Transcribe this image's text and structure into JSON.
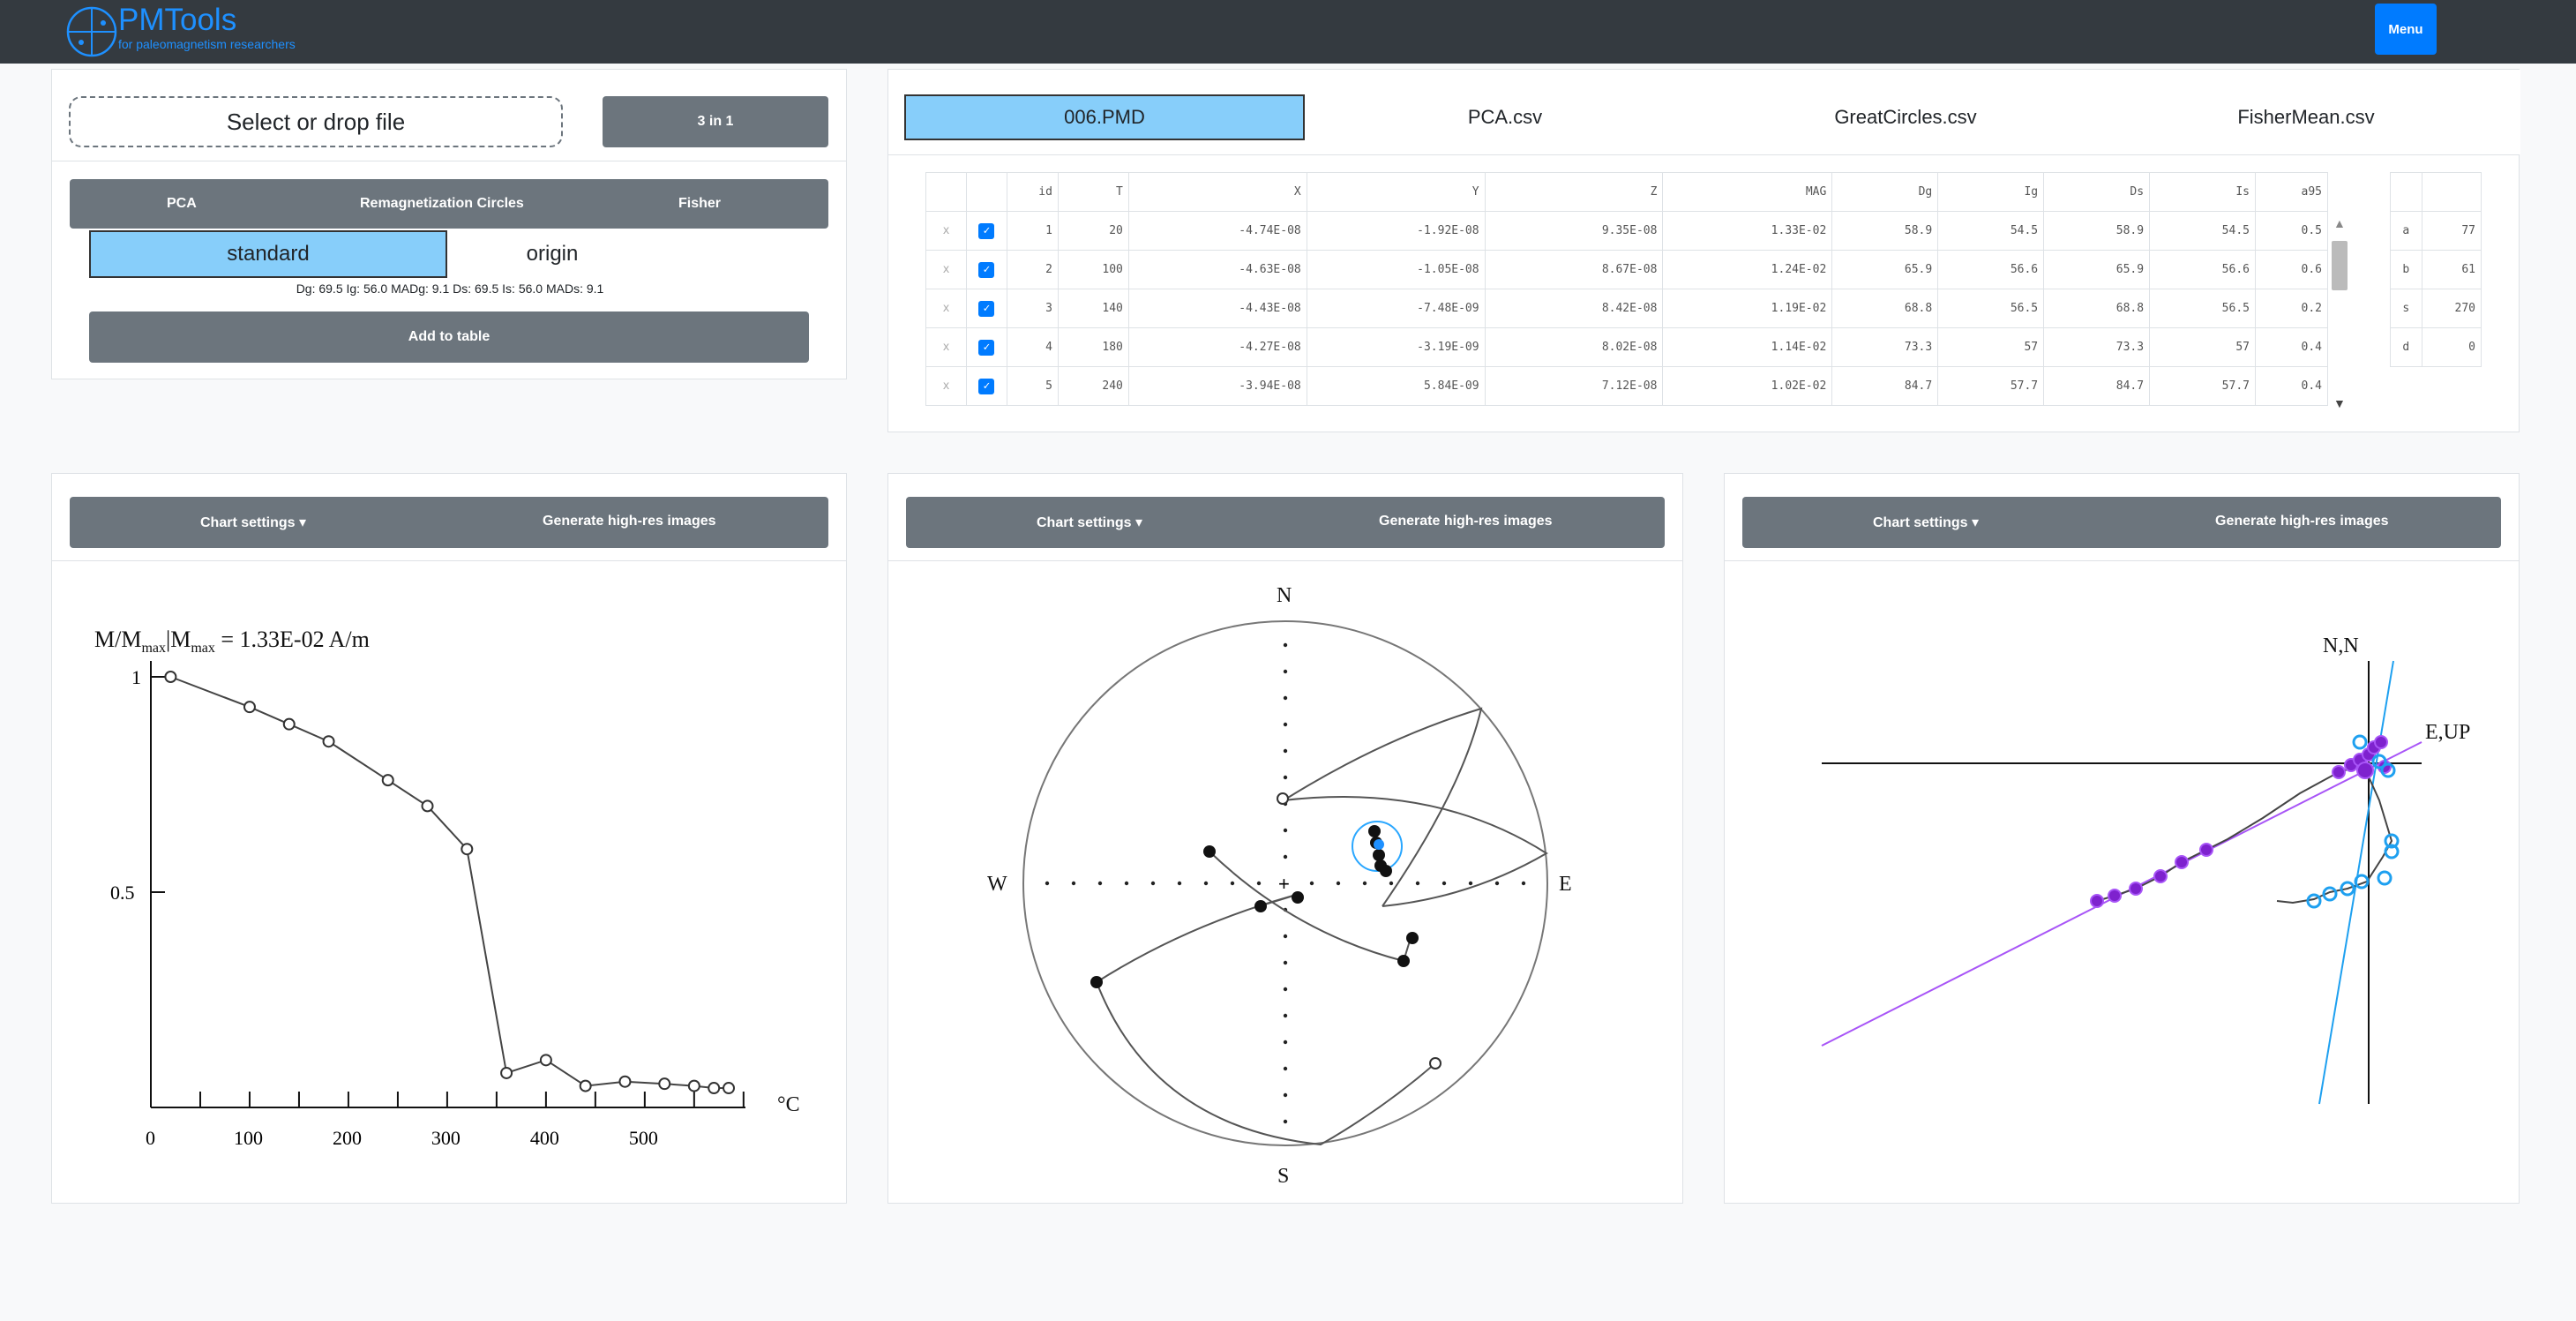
{
  "navbar": {
    "brand": "PMTools",
    "subtitle": "for paleomagnetism researchers",
    "menu_label": "Menu"
  },
  "upload": {
    "drop_label": "Select or drop file",
    "three_in_one_label": "3 in 1"
  },
  "method_tabs": [
    "PCA",
    "Remagnetization Circles",
    "Fisher"
  ],
  "mode": {
    "standard_label": "standard",
    "origin_label": "origin"
  },
  "stats_text": "Dg: 69.5 Ig: 56.0 MADg: 9.1 Ds: 69.5 Is: 56.0 MADs: 9.1",
  "add_to_table_label": "Add to table",
  "file_tabs": [
    "006.PMD",
    "PCA.csv",
    "GreatCircles.csv",
    "FisherMean.csv"
  ],
  "table": {
    "headers": [
      "id",
      "T",
      "X",
      "Y",
      "Z",
      "MAG",
      "Dg",
      "Ig",
      "Ds",
      "Is",
      "a95"
    ],
    "remove_symbol": "x",
    "rows": [
      [
        "1",
        "20",
        "-4.74E-08",
        "-1.92E-08",
        "9.35E-08",
        "1.33E-02",
        "58.9",
        "54.5",
        "58.9",
        "54.5",
        "0.5"
      ],
      [
        "2",
        "100",
        "-4.63E-08",
        "-1.05E-08",
        "8.67E-08",
        "1.24E-02",
        "65.9",
        "56.6",
        "65.9",
        "56.6",
        "0.6"
      ],
      [
        "3",
        "140",
        "-4.43E-08",
        "-7.48E-09",
        "8.42E-08",
        "1.19E-02",
        "68.8",
        "56.5",
        "68.8",
        "56.5",
        "0.2"
      ],
      [
        "4",
        "180",
        "-4.27E-08",
        "-3.19E-09",
        "8.02E-08",
        "1.14E-02",
        "73.3",
        "57",
        "73.3",
        "57",
        "0.4"
      ],
      [
        "5",
        "240",
        "-3.94E-08",
        "5.84E-09",
        "7.12E-08",
        "1.02E-02",
        "84.7",
        "57.7",
        "84.7",
        "57.7",
        "0.4"
      ]
    ]
  },
  "params": [
    {
      "key": "a",
      "value": "77"
    },
    {
      "key": "b",
      "value": "61"
    },
    {
      "key": "s",
      "value": "270"
    },
    {
      "key": "d",
      "value": "0"
    }
  ],
  "chart_panels": {
    "settings_label": "Chart settings ▾",
    "hires_label": "Generate high-res images"
  },
  "colors": {
    "navbar": "#343a40",
    "accent": "#007bff",
    "selected_tab": "#87cefa",
    "button": "#6c757d",
    "pca_line": "#a855f7",
    "gc_line": "#1ea0f0"
  },
  "chart_data": [
    {
      "type": "line",
      "title": "M/Mmax|Mmax = 1.33E-02 A/m",
      "title_main": "M/M",
      "title_sub1": "max",
      "title_mid": "|M",
      "title_sub2": "max",
      "title_tail": " = 1.33E-02 A/m",
      "xlabel": "°C",
      "x": [
        20,
        100,
        140,
        180,
        240,
        280,
        320,
        360,
        400,
        440,
        480,
        520,
        550,
        570,
        585
      ],
      "y": [
        1.0,
        0.93,
        0.89,
        0.85,
        0.76,
        0.7,
        0.6,
        0.08,
        0.11,
        0.05,
        0.06,
        0.055,
        0.05,
        0.045,
        0.045
      ],
      "xlim": [
        0,
        620
      ],
      "ylim": [
        0,
        1
      ],
      "xticks": [
        "0",
        "100",
        "200",
        "300",
        "400",
        "500"
      ],
      "yticks": [
        "0.5",
        "1"
      ]
    },
    {
      "type": "scatter",
      "title": "stereonet",
      "directions": [
        "N",
        "E",
        "S",
        "W"
      ]
    },
    {
      "type": "scatter",
      "title": "zijderveld",
      "axis_labels": [
        "N,N",
        "E,UP"
      ]
    }
  ]
}
